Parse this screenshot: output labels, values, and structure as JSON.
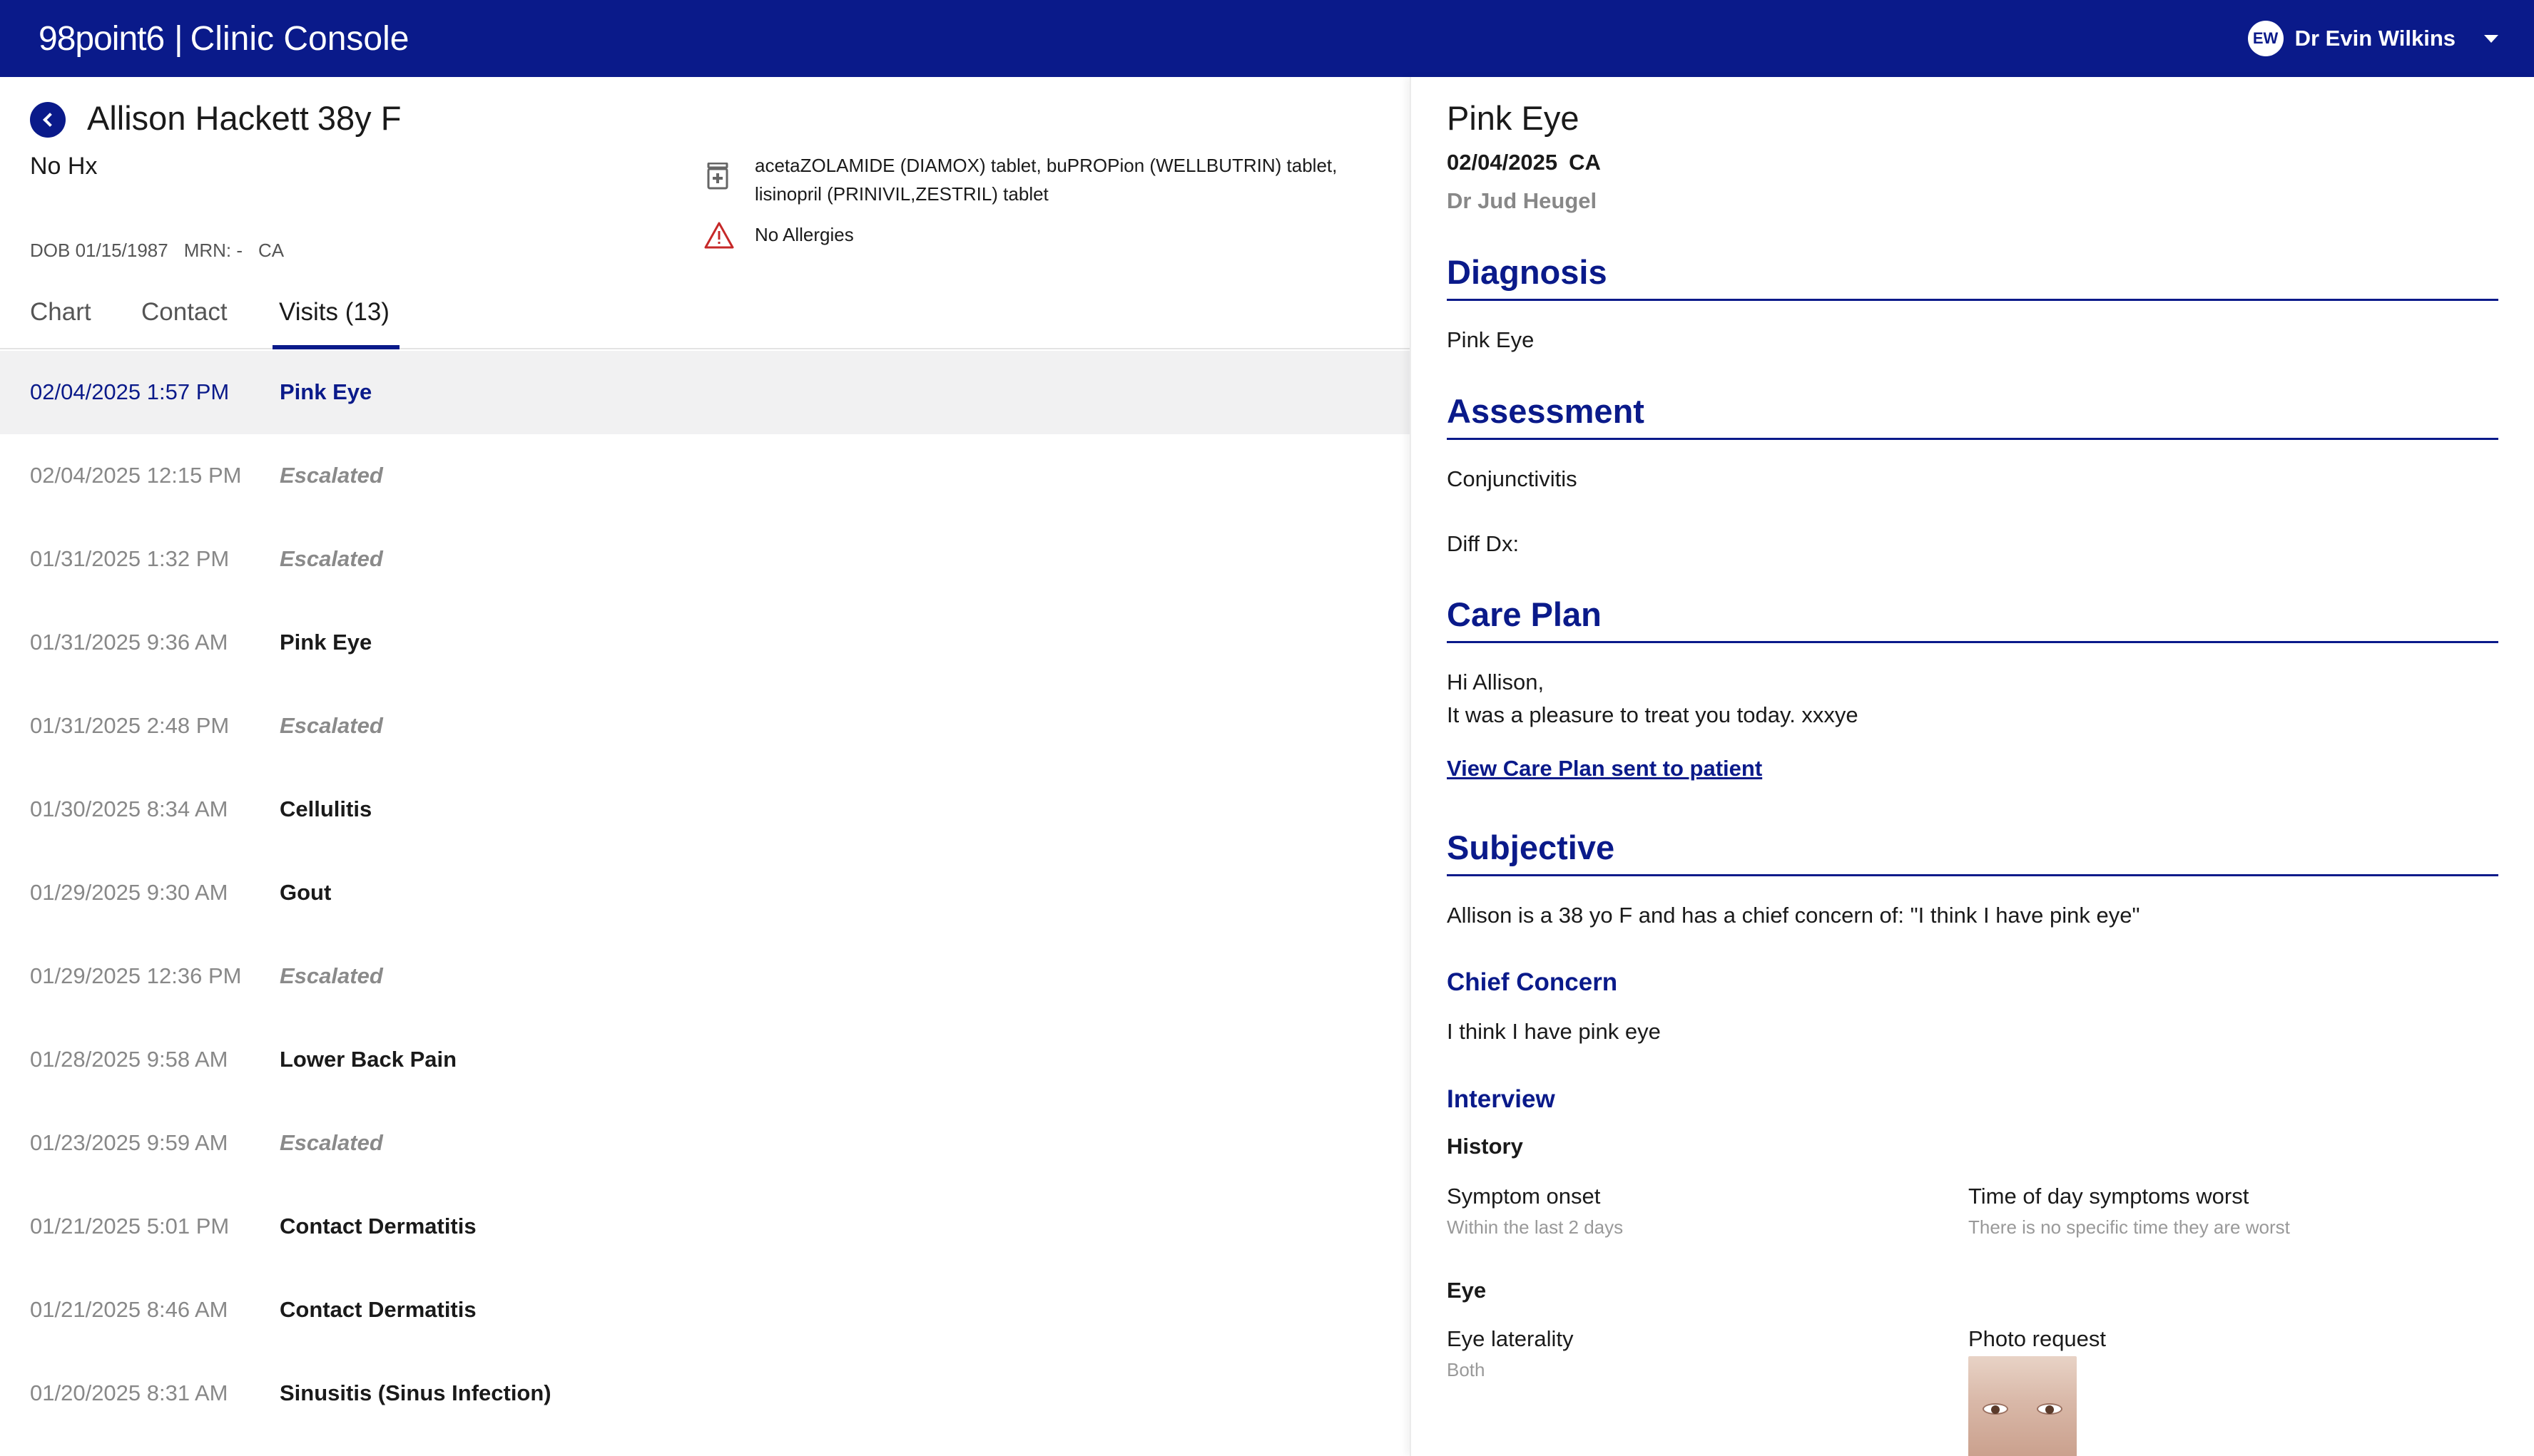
{
  "header": {
    "brand_logo": "98point6",
    "brand_sep": "|",
    "brand_title": "Clinic Console",
    "user_initials": "EW",
    "user_name": "Dr Evin Wilkins"
  },
  "patient": {
    "name": "Allison Hackett",
    "age_sex": "38y F",
    "history": "No Hx",
    "dob": "DOB 01/15/1987",
    "mrn": "MRN: -",
    "state": "CA",
    "medications": "acetaZOLAMIDE (DIAMOX) tablet, buPROPion (WELLBUTRIN) tablet, lisinopril (PRINIVIL,ZESTRIL) tablet",
    "allergies": "No Allergies"
  },
  "tabs": [
    {
      "label": "Chart"
    },
    {
      "label": "Contact"
    },
    {
      "label": "Visits (13)"
    }
  ],
  "visits": [
    {
      "date": "02/04/2025 1:57 PM",
      "title": "Pink Eye",
      "escalated": false,
      "selected": true
    },
    {
      "date": "02/04/2025 12:15 PM",
      "title": "Escalated",
      "escalated": true
    },
    {
      "date": "01/31/2025 1:32 PM",
      "title": "Escalated",
      "escalated": true
    },
    {
      "date": "01/31/2025 9:36 AM",
      "title": "Pink Eye",
      "escalated": false
    },
    {
      "date": "01/31/2025 2:48 PM",
      "title": "Escalated",
      "escalated": true
    },
    {
      "date": "01/30/2025 8:34 AM",
      "title": "Cellulitis",
      "escalated": false
    },
    {
      "date": "01/29/2025 9:30 AM",
      "title": "Gout",
      "escalated": false
    },
    {
      "date": "01/29/2025 12:36 PM",
      "title": "Escalated",
      "escalated": true
    },
    {
      "date": "01/28/2025 9:58 AM",
      "title": "Lower Back Pain",
      "escalated": false
    },
    {
      "date": "01/23/2025 9:59 AM",
      "title": "Escalated",
      "escalated": true
    },
    {
      "date": "01/21/2025 5:01 PM",
      "title": "Contact Dermatitis",
      "escalated": false
    },
    {
      "date": "01/21/2025 8:46 AM",
      "title": "Contact Dermatitis",
      "escalated": false
    },
    {
      "date": "01/20/2025 8:31 AM",
      "title": "Sinusitis (Sinus Infection)",
      "escalated": false
    }
  ],
  "detail": {
    "title": "Pink Eye",
    "date": "02/04/2025",
    "state": "CA",
    "doctor": "Dr Jud Heugel",
    "diagnosis_heading": "Diagnosis",
    "diagnosis": "Pink Eye",
    "assessment_heading": "Assessment",
    "assessment": "Conjunctivitis",
    "diff_dx": "Diff Dx:",
    "care_plan_heading": "Care Plan",
    "care_plan_greeting": "Hi Allison,",
    "care_plan_body": "It was a pleasure to treat you today. xxxye",
    "care_plan_link": "View Care Plan sent to patient",
    "subjective_heading": "Subjective",
    "subjective_text": "Allison is a 38 yo F and has a chief concern of: \"I think I have pink eye\"",
    "chief_concern_heading": "Chief Concern",
    "chief_concern": "I think I have pink eye",
    "interview_heading": "Interview",
    "history_heading": "History",
    "symptom_onset_label": "Symptom onset",
    "symptom_onset_value": "Within the last 2 days",
    "time_of_day_label": "Time of day symptoms worst",
    "time_of_day_value": "There is no specific time they are worst",
    "eye_heading": "Eye",
    "eye_laterality_label": "Eye laterality",
    "eye_laterality_value": "Both",
    "photo_request_label": "Photo request"
  },
  "colors": {
    "brand": "#0a1a8a",
    "selected_row": "#f1f1f2",
    "muted": "#888888",
    "warning": "#c62828"
  },
  "icons": [
    "back-icon",
    "medication-icon",
    "warning-icon",
    "chevron-down-icon"
  ]
}
